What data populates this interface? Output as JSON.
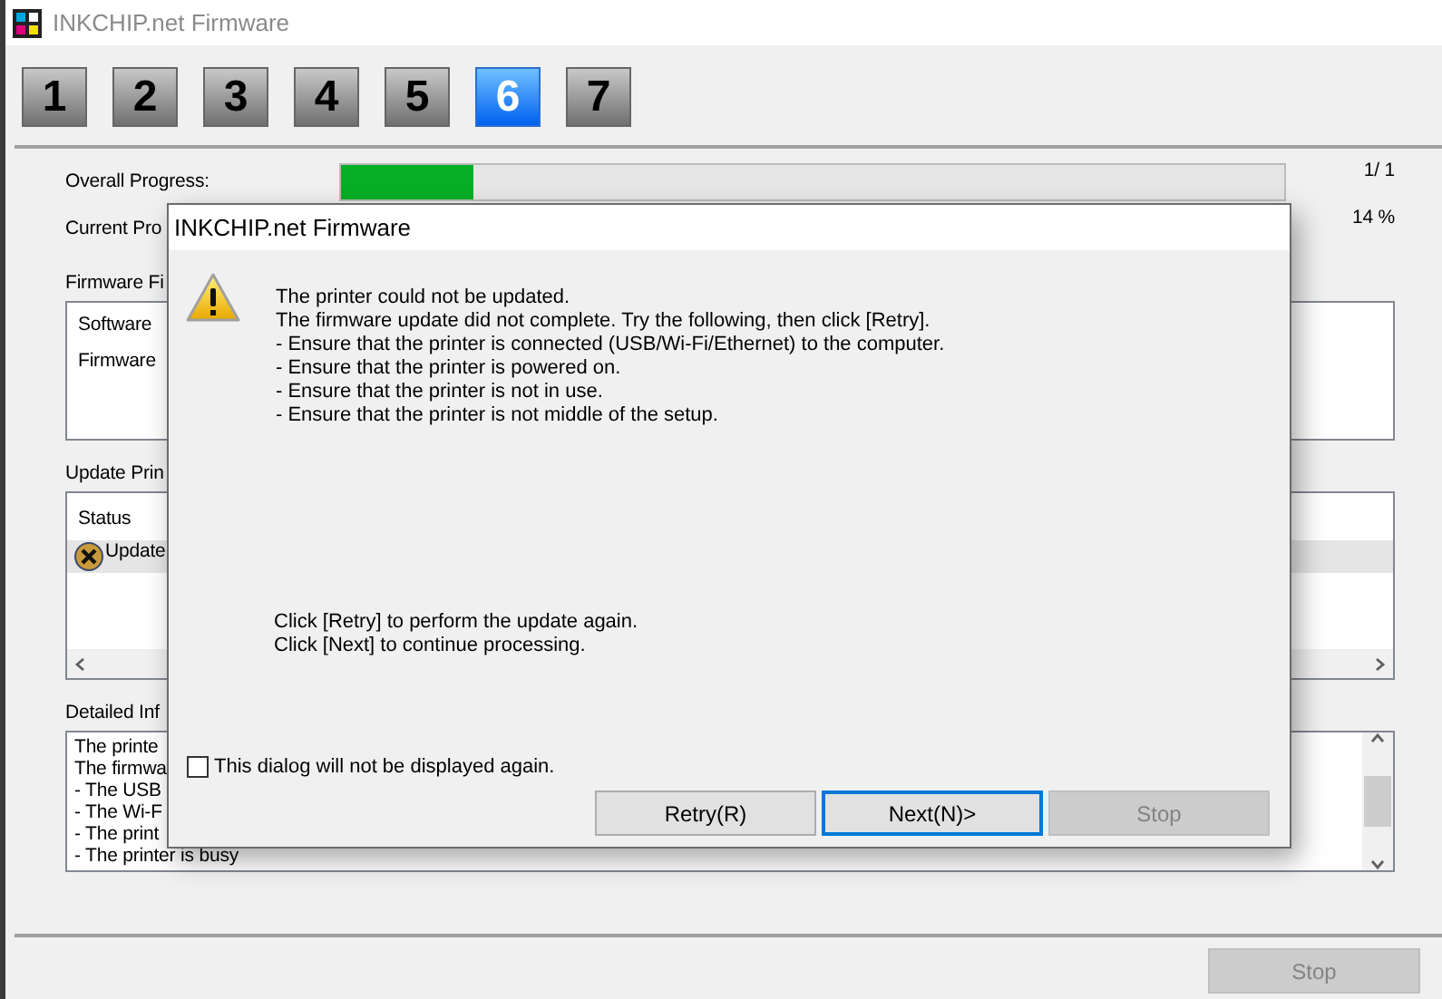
{
  "window": {
    "title": "INKCHIP.net Firmware"
  },
  "steps": [
    {
      "label": "1",
      "selected": false
    },
    {
      "label": "2",
      "selected": false
    },
    {
      "label": "3",
      "selected": false
    },
    {
      "label": "4",
      "selected": false
    },
    {
      "label": "5",
      "selected": false
    },
    {
      "label": "6",
      "selected": true
    },
    {
      "label": "7",
      "selected": false
    }
  ],
  "overall_progress": {
    "label": "Overall Progress:",
    "level": 0.14,
    "reading": "1/ 1"
  },
  "current_progress": {
    "label": "Current Pro",
    "reading": "14 %"
  },
  "firmware_files": {
    "label": "Firmware Fi",
    "lines": [
      "Software",
      "Firmware"
    ]
  },
  "update_printers": {
    "label": "Update Prin",
    "column": "Status",
    "rows": [
      {
        "kind": "error",
        "text": "Update",
        "selected": true
      }
    ]
  },
  "detailed_info": {
    "label": "Detailed Inf",
    "lines": [
      "The printe",
      "The firmwa",
      "- The USB",
      "- The Wi-F",
      "- The print",
      "- The printer is busy"
    ]
  },
  "stop_button": {
    "label": "Stop",
    "disabled": true
  },
  "dialog": {
    "title": "INKCHIP.net Firmware",
    "message_lines": [
      "The printer could not be updated.",
      "The firmware update did not complete. Try the following, then click [Retry].",
      "- Ensure that the printer is connected (USB/Wi-Fi/Ethernet) to the computer.",
      "- Ensure that the printer is powered on.",
      "- Ensure that the printer is not in use.",
      "- Ensure that the printer is not middle of the setup."
    ],
    "hint_lines": [
      "Click [Retry] to perform the update again.",
      "Click [Next] to continue processing."
    ],
    "checkbox": {
      "label": "This dialog will not be displayed again.",
      "checked": false
    },
    "buttons": [
      {
        "label": "Retry(R)",
        "focused": false,
        "disabled": false
      },
      {
        "label": "Next(N)>",
        "focused": true,
        "disabled": false
      },
      {
        "label": "Stop",
        "focused": false,
        "disabled": true
      }
    ]
  }
}
